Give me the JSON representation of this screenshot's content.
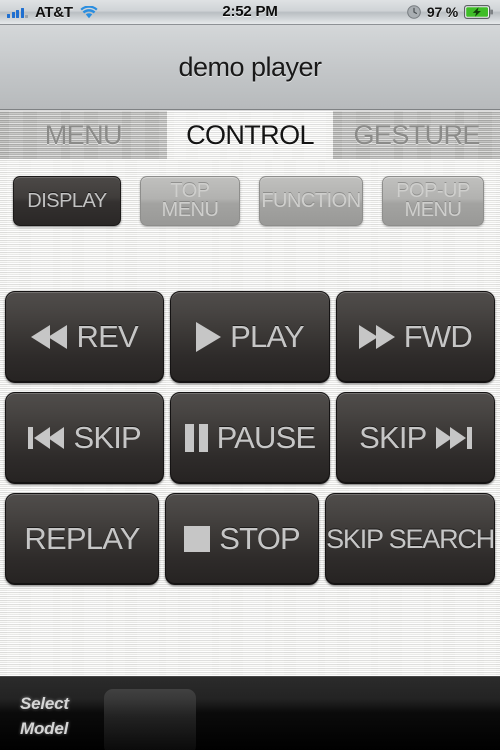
{
  "statusbar": {
    "signal_icon": "signal-bars-icon",
    "carrier": "AT&T",
    "wifi_icon": "wifi-icon",
    "time": "2:52 PM",
    "alarm_icon": "clock-icon",
    "battery_percent": "97 %",
    "battery_icon": "battery-charging-icon",
    "signal_color": "#1f6fd0",
    "battery_color": "#3fbd28"
  },
  "header": {
    "title": "demo player"
  },
  "tabs": [
    {
      "label": "MENU",
      "active": false
    },
    {
      "label": "CONTROL",
      "active": true
    },
    {
      "label": "GESTURE",
      "active": false
    }
  ],
  "toprow": [
    {
      "label": "DISPLAY",
      "style": "dark"
    },
    {
      "label_line1": "TOP",
      "label_line2": "MENU",
      "style": "light"
    },
    {
      "label": "FUNCTION",
      "style": "light"
    },
    {
      "label_line1": "POP-UP",
      "label_line2": "MENU",
      "style": "light"
    }
  ],
  "transport_grid": [
    [
      {
        "label": "REV",
        "icon": "rewind-icon",
        "icon_position": "before"
      },
      {
        "label": "PLAY",
        "icon": "play-icon",
        "icon_position": "before"
      },
      {
        "label": "FWD",
        "icon": "fast-forward-icon",
        "icon_position": "before"
      }
    ],
    [
      {
        "label": "SKIP",
        "icon": "skip-previous-icon",
        "icon_position": "before"
      },
      {
        "label": "PAUSE",
        "icon": "pause-icon",
        "icon_position": "before"
      },
      {
        "label": "SKIP",
        "icon": "skip-next-icon",
        "icon_position": "after"
      }
    ],
    [
      {
        "label": "REPLAY",
        "icon": "",
        "icon_position": "none"
      },
      {
        "label": "STOP",
        "icon": "stop-icon",
        "icon_position": "before"
      },
      {
        "label": "SKIP SEARCH",
        "icon": "",
        "icon_position": "none"
      }
    ]
  ],
  "bottombar": {
    "select_line1": "Select",
    "select_line2": "Model"
  }
}
